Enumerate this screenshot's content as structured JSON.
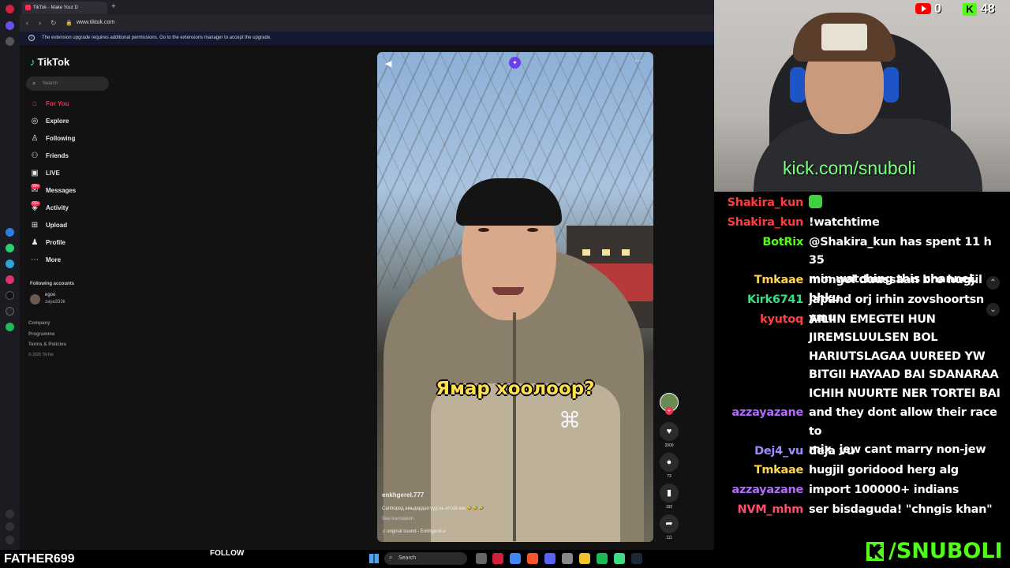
{
  "browser": {
    "tab_title": "TikTok - Make Your D",
    "new_tab_glyph": "+",
    "url": "www.tiktok.com",
    "notice": "The extension upgrade requires additional permissions. Go to the extensions manager to accept the upgrade."
  },
  "tiktok": {
    "logo": "TikTok",
    "search_placeholder": "Search",
    "menu": [
      {
        "label": "For You",
        "icon": "home-icon",
        "glyph": "⌂",
        "active": true
      },
      {
        "label": "Explore",
        "icon": "compass-icon",
        "glyph": "◎"
      },
      {
        "label": "Following",
        "icon": "following-icon",
        "glyph": "♙"
      },
      {
        "label": "Friends",
        "icon": "friends-icon",
        "glyph": "⚇"
      },
      {
        "label": "LIVE",
        "icon": "live-icon",
        "glyph": "▣"
      },
      {
        "label": "Messages",
        "icon": "messages-icon",
        "glyph": "✉",
        "badge": "99+"
      },
      {
        "label": "Activity",
        "icon": "activity-icon",
        "glyph": "◈",
        "badge": "99+"
      },
      {
        "label": "Upload",
        "icon": "upload-icon",
        "glyph": "⊞"
      },
      {
        "label": "Profile",
        "icon": "profile-icon",
        "glyph": "♟"
      },
      {
        "label": "More",
        "icon": "more-icon",
        "glyph": "⋯"
      }
    ],
    "following_heading": "Following accounts",
    "following_accounts": [
      {
        "name": "egoo",
        "handle": "zaya333k"
      }
    ],
    "footer": [
      "Company",
      "Programme",
      "Terms & Policies"
    ],
    "copyright": "© 2025 TikTok"
  },
  "video": {
    "caption": "Ямар хоолоор?",
    "author": "enkhgerel.777",
    "description": "Саппород амьдардаггүүд нь аттай юм 🤣🤣🤣",
    "see_translation": "See translation",
    "sound": "original sound - Enkhgerel.e",
    "likes": "2000",
    "comments": "73",
    "saves": "192",
    "shares": "111"
  },
  "stream": {
    "youtube_count": "0",
    "kick_count": "48",
    "cam_overlay": "kick.com/snuboli",
    "streamer_name": "FATHER699",
    "follow_label": "FOLLOW",
    "brand": "/SNUBOLI",
    "brand_letter": "K"
  },
  "chat": [
    {
      "user": "Shakira_kun",
      "color": "#ff3b3b",
      "text": "",
      "emote": true
    },
    {
      "user": "Shakira_kun",
      "color": "#ff3b3b",
      "text": "!watchtime"
    },
    {
      "user": "BotRix",
      "color": "#53fc18",
      "text": "@Shakira_kun has spent 11 h 35\nmin watching this channel."
    },
    {
      "user": "Tmkaae",
      "color": "#ffd54a",
      "text": "mongol duussaan bro hugjil bhku"
    },
    {
      "user": "Kirk6741",
      "color": "#3ddc84",
      "text": "japand orj irhin zovshoortsn ymu"
    },
    {
      "user": "kyutoq",
      "color": "#ff4040",
      "text": "AILIIN EMEGTEI HUN\nJIREMSLUULSEN BOL\nHARIUTSLAGAA UUREED YW\nBITGII HAYAAD BAI SDANARAA\nICHIH NUURTE NER TORTEI BAI"
    },
    {
      "user": "azzayazane",
      "color": "#b36bff",
      "text": "and they dont allow their race to\nmix, jew cant marry non-jew"
    },
    {
      "user": "Dej4_vu",
      "color": "#9d8cff",
      "text": "deja vu"
    },
    {
      "user": "Tmkaae",
      "color": "#ffd54a",
      "text": "hugjil goridood herg alg"
    },
    {
      "user": "azzayazane",
      "color": "#b36bff",
      "text": "import 100000+ indians"
    },
    {
      "user": "NVM_mhm",
      "color": "#ff4d6d",
      "text": "ser bisdaguda! \"chngis khan\""
    }
  ],
  "taskbar": {
    "search": "Search"
  }
}
